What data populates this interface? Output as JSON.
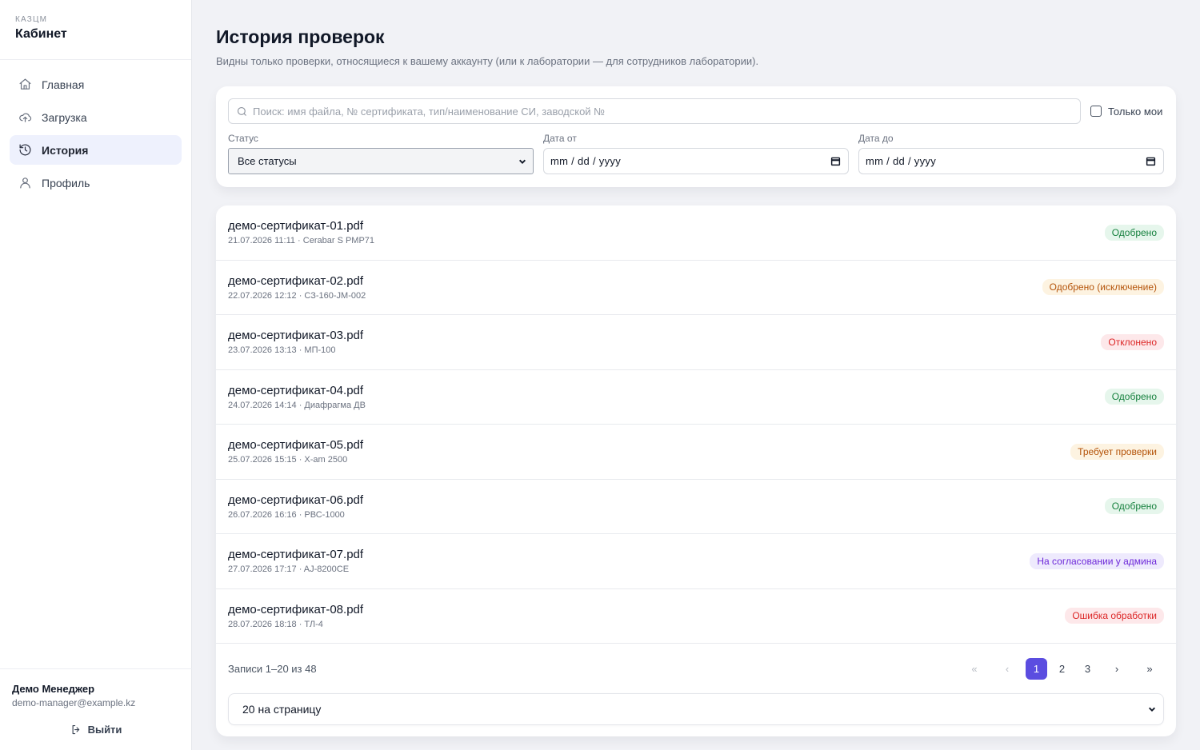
{
  "sidebar": {
    "org": "КАЗЦМ",
    "title": "Кабинет",
    "items": [
      {
        "label": "Главная",
        "icon": "home-icon"
      },
      {
        "label": "Загрузка",
        "icon": "upload-cloud-icon"
      },
      {
        "label": "История",
        "icon": "history-icon",
        "active": true
      },
      {
        "label": "Профиль",
        "icon": "user-icon"
      }
    ],
    "user_name": "Демо Менеджер",
    "user_email": "demo-manager@example.kz",
    "logout_label": "Выйти"
  },
  "main": {
    "title": "История проверок",
    "subtitle": "Видны только проверки, относящиеся к вашему аккаунту (или к лаборатории — для сотрудников лаборатории)."
  },
  "filters": {
    "search_placeholder": "Поиск: имя файла, № сертификата, тип/наименование СИ, заводской №",
    "only_mine_label": "Только мои",
    "status_label": "Статус",
    "status_value": "Все статусы",
    "date_from_label": "Дата от",
    "date_from_value": "mm / dd / yyyy",
    "date_to_label": "Дата до",
    "date_to_value": "mm / dd / yyyy"
  },
  "records": [
    {
      "name": "демо-сертификат-01.pdf",
      "meta": "21.07.2026 11:11 · Cerabar S PMP71",
      "status": "Одобрено",
      "color": "green"
    },
    {
      "name": "демо-сертификат-02.pdf",
      "meta": "22.07.2026 12:12 · СЗ-160-ЈМ-002",
      "status": "Одобрено (исключение)",
      "color": "orange"
    },
    {
      "name": "демо-сертификат-03.pdf",
      "meta": "23.07.2026 13:13 · МП-100",
      "status": "Отклонено",
      "color": "red"
    },
    {
      "name": "демо-сертификат-04.pdf",
      "meta": "24.07.2026 14:14 · Диафрагма ДВ",
      "status": "Одобрено",
      "color": "green"
    },
    {
      "name": "демо-сертификат-05.pdf",
      "meta": "25.07.2026 15:15 · X-am 2500",
      "status": "Требует проверки",
      "color": "orange"
    },
    {
      "name": "демо-сертификат-06.pdf",
      "meta": "26.07.2026 16:16 · РВС-1000",
      "status": "Одобрено",
      "color": "green"
    },
    {
      "name": "демо-сертификат-07.pdf",
      "meta": "27.07.2026 17:17 · AJ-8200CE",
      "status": "На согласовании у админа",
      "color": "purple"
    },
    {
      "name": "демо-сертификат-08.pdf",
      "meta": "28.07.2026 18:18 · ТЛ-4",
      "status": "Ошибка обработки",
      "color": "red"
    }
  ],
  "pagination": {
    "records_text": "Записи 1–20 из 48",
    "first": "«",
    "prev": "‹",
    "pages": [
      "1",
      "2",
      "3"
    ],
    "current": "1",
    "next": "›",
    "last": "»",
    "per_page": "20 на страницу"
  },
  "colors": {
    "accent": "#5b4de0",
    "active_nav_bg": "#eef1fd",
    "approved": "#15803d",
    "warning": "#b45309",
    "error": "#dc2626",
    "pending_admin": "#6d28d9"
  }
}
